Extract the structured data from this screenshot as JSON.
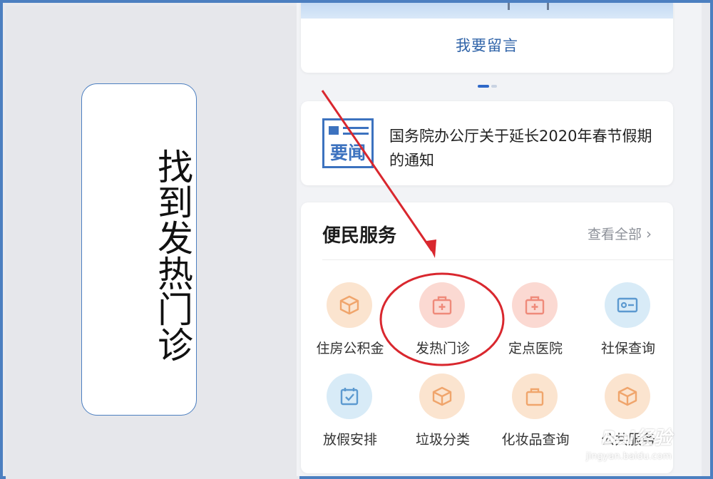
{
  "caption": {
    "text": "找到发热门诊"
  },
  "banner": {
    "button_label": "我要留言"
  },
  "carousel": {
    "pages": 2,
    "active": 1
  },
  "news": {
    "icon_label": "要闻",
    "title": "国务院办公厅关于延长2020年春节假期的通知"
  },
  "services": {
    "title": "便民服务",
    "view_all": "查看全部",
    "items": [
      {
        "label": "住房公积金",
        "icon": "box-icon",
        "color": "#f3b98a"
      },
      {
        "label": "发热门诊",
        "icon": "medical-kit-icon",
        "color": "#f29a8c"
      },
      {
        "label": "定点医院",
        "icon": "medical-kit-icon",
        "color": "#f29a8c"
      },
      {
        "label": "社保查询",
        "icon": "id-card-icon",
        "color": "#6fa7d6"
      },
      {
        "label": "放假安排",
        "icon": "calendar-check-icon",
        "color": "#6fa7d6"
      },
      {
        "label": "垃圾分类",
        "icon": "box-icon",
        "color": "#f3b98a"
      },
      {
        "label": "化妆品查询",
        "icon": "bag-icon",
        "color": "#f3b98a"
      },
      {
        "label": "公共服务",
        "icon": "box-icon",
        "color": "#f3b98a"
      }
    ]
  },
  "annotations": {
    "arrow_color": "#d9272e",
    "circle_color": "#d9272e"
  },
  "watermark": {
    "brand": "Bai经验",
    "url": "jingyan.baidu.com"
  }
}
